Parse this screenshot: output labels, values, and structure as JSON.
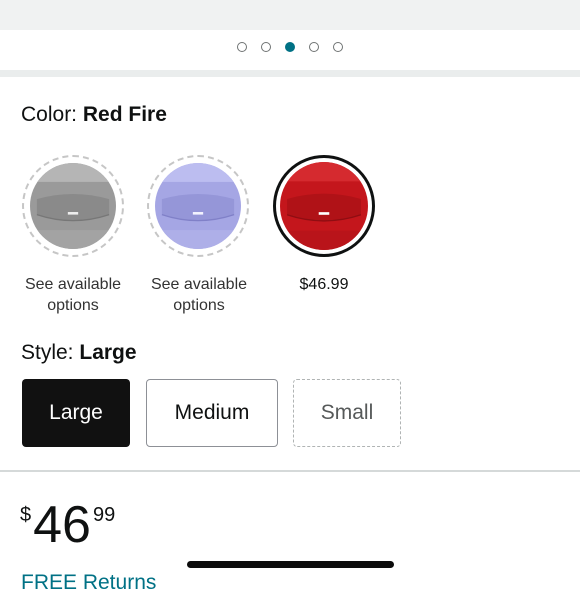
{
  "carousel": {
    "dot_count": 5,
    "active_index": 2
  },
  "color": {
    "label": "Color:",
    "value": "Red Fire",
    "swatches": [
      {
        "name": "gray",
        "color": "#9a9a9a",
        "caption": "See available options",
        "available": false
      },
      {
        "name": "lavender",
        "color": "#a5a6e4",
        "caption": "See available options",
        "available": false
      },
      {
        "name": "red-fire",
        "color": "#c4161c",
        "caption": "$46.99",
        "available": true,
        "selected": true
      }
    ]
  },
  "style": {
    "label": "Style:",
    "value": "Large",
    "options": [
      "Large",
      "Medium",
      "Small"
    ]
  },
  "price": {
    "currency": "$",
    "whole": "46",
    "fraction": "99"
  },
  "returns": {
    "label": "FREE Returns"
  },
  "colors": {
    "accent": "#007185",
    "text": "#0f1111"
  }
}
